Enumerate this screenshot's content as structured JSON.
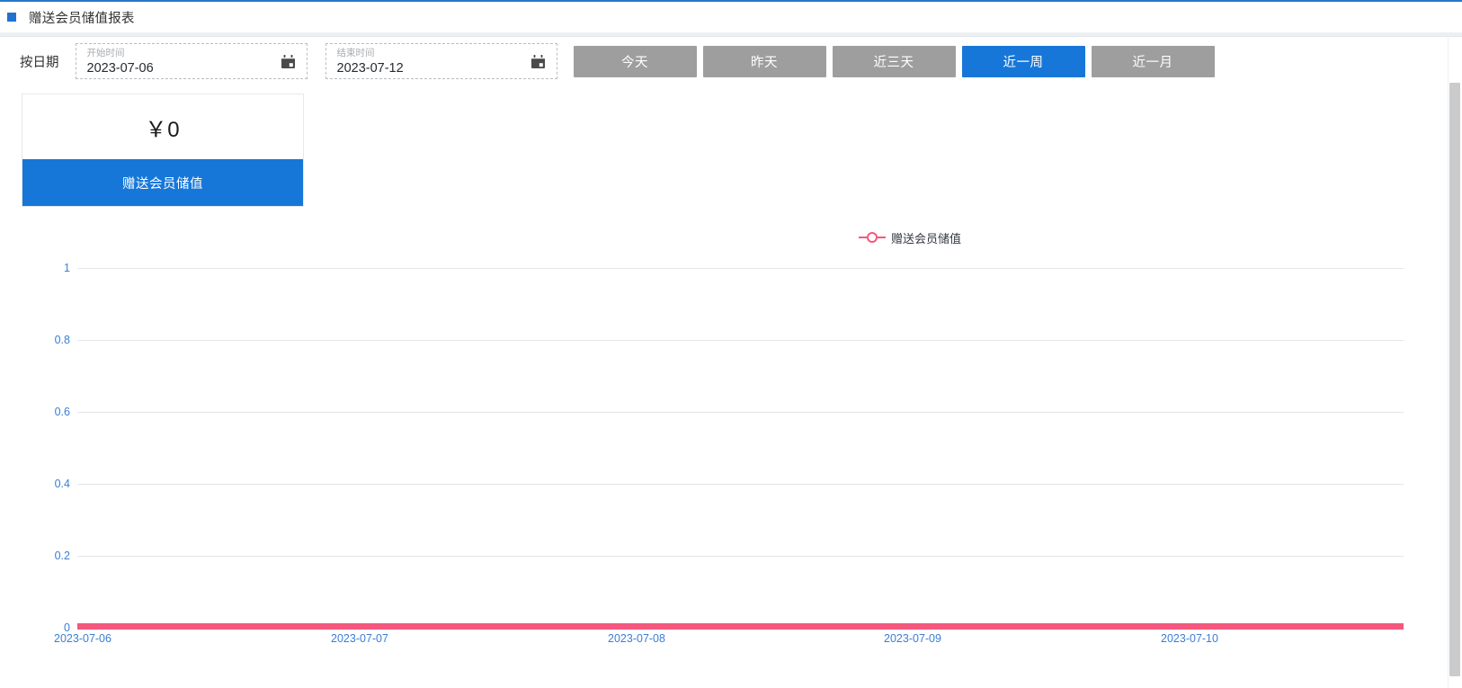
{
  "window": {
    "title": "赠送会员储值报表",
    "bullet_icon": "blue-square-icon",
    "accent_color": "#1677d9",
    "line_color": "#f4587e"
  },
  "filters": {
    "label": "按日期",
    "start": {
      "placeholder": "开始时间",
      "value": "2023-07-06",
      "icon": "calendar-icon"
    },
    "end": {
      "placeholder": "结束时间",
      "value": "2023-07-12",
      "icon": "calendar-icon"
    },
    "range_buttons": [
      {
        "label": "今天",
        "active": false
      },
      {
        "label": "昨天",
        "active": false
      },
      {
        "label": "近三天",
        "active": false
      },
      {
        "label": "近一周",
        "active": true
      },
      {
        "label": "近一月",
        "active": false
      }
    ]
  },
  "stat_card": {
    "value": "￥0",
    "footer_label": "赠送会员储值"
  },
  "chart_data": {
    "type": "line",
    "title": "",
    "xlabel": "",
    "ylabel": "",
    "legend": [
      "赠送会员储值"
    ],
    "legend_position": "top-center",
    "grid": true,
    "categories": [
      "2023-07-06",
      "2023-07-07",
      "2023-07-08",
      "2023-07-09",
      "2023-07-10"
    ],
    "x": [
      "2023-07-06",
      "2023-07-07",
      "2023-07-08",
      "2023-07-09",
      "2023-07-10"
    ],
    "series": [
      {
        "name": "赠送会员储值",
        "values": [
          0,
          0,
          0,
          0,
          0
        ],
        "color": "#f4587e",
        "marker": "hollow-circle"
      }
    ],
    "yticks": [
      "1",
      "0.8",
      "0.6",
      "0.4",
      "0.2",
      "0"
    ],
    "ylim": [
      0,
      1
    ],
    "tick_color": "#3a7fd4"
  },
  "scrollbar": {
    "name": "vertical-scrollbar"
  }
}
